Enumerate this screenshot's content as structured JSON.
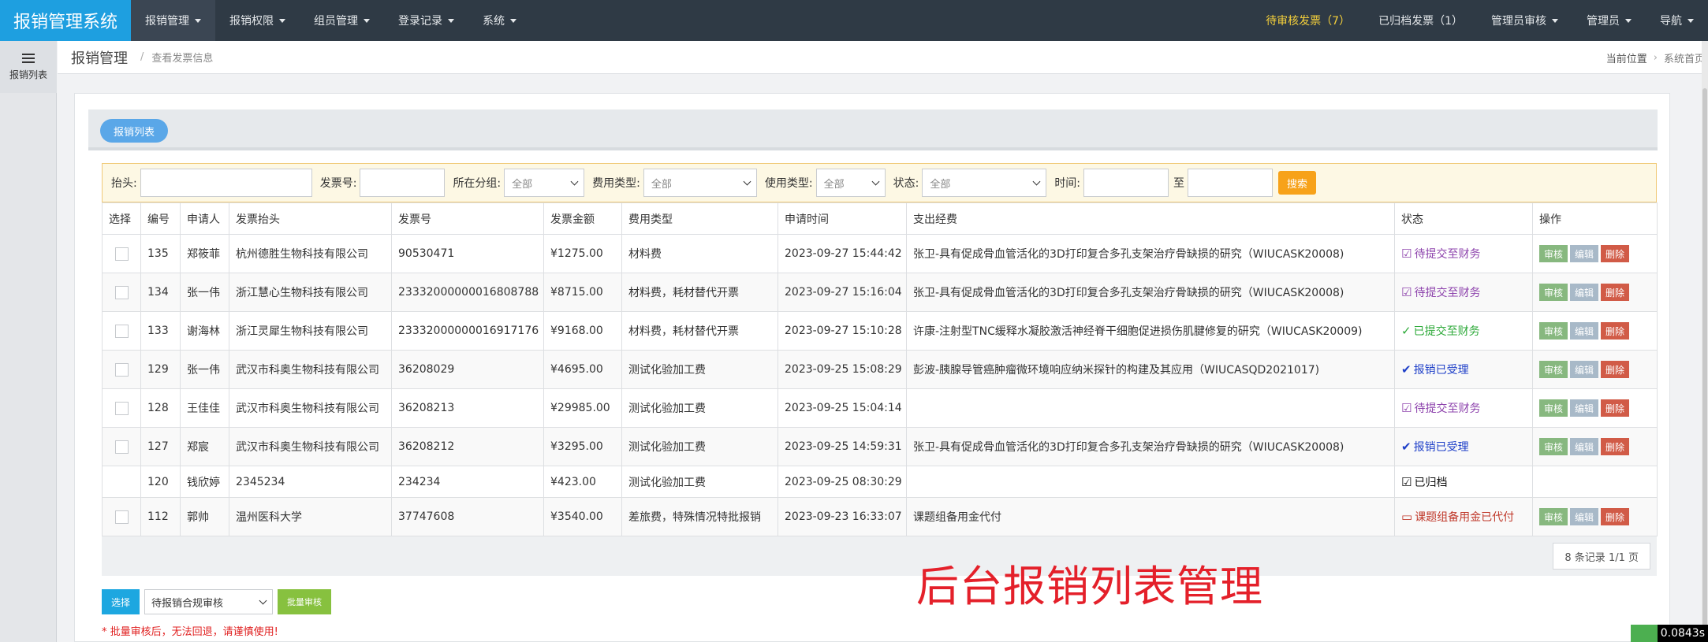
{
  "brand": "报销管理系统",
  "nav_left": [
    {
      "label": "报销管理"
    },
    {
      "label": "报销权限"
    },
    {
      "label": "组员管理"
    },
    {
      "label": "登录记录"
    },
    {
      "label": "系统"
    }
  ],
  "nav_right": {
    "pending": "待审核发票（7）",
    "archived": "已归档发票（1）",
    "admin_audit": "管理员审核",
    "admin": "管理员",
    "guide": "导航"
  },
  "sidebar": {
    "label": "报销列表",
    "icon": "list-icon"
  },
  "breadcrumb": {
    "title": "报销管理",
    "sep": "/",
    "sub": "查看发票信息",
    "position": "当前位置",
    "arrow": "›",
    "home": "系统首页"
  },
  "tab": {
    "label": "报销列表"
  },
  "filters": {
    "header_label": "抬头:",
    "invoice_no_label": "发票号:",
    "group_label": "所在分组:",
    "group_value": "全部",
    "expense_type_label": "费用类型:",
    "expense_type_value": "全部",
    "use_type_label": "使用类型:",
    "use_type_value": "全部",
    "status_label": "状态:",
    "status_value": "全部",
    "time_label": "时间:",
    "to_label": "至",
    "search_button": "搜索"
  },
  "table": {
    "columns": [
      "选择",
      "编号",
      "申请人",
      "发票抬头",
      "发票号",
      "发票金额",
      "费用类型",
      "申请时间",
      "支出经费",
      "状态",
      "操作"
    ],
    "action_labels": {
      "audit": "审核",
      "edit": "编辑",
      "delete": "删除"
    },
    "rows": [
      {
        "id": "135",
        "applicant": "郑筱菲",
        "header": "杭州德胜生物科技有限公司",
        "invoice_no": "90530471",
        "amount": "¥1275.00",
        "type": "材料费",
        "time": "2023-09-27 15:44:42",
        "fund": "张卫-具有促成骨血管活化的3D打印复合多孔支架治疗骨缺损的研究（WIUCASK20008)",
        "status": "待提交至财务",
        "status_kind": "purple",
        "checkbox": true,
        "actions": true
      },
      {
        "id": "134",
        "applicant": "张一伟",
        "header": "浙江慧心生物科技有限公司",
        "invoice_no": "23332000000016808788",
        "amount": "¥8715.00",
        "type": "材料费，耗材替代开票",
        "time": "2023-09-27 15:16:04",
        "fund": "张卫-具有促成骨血管活化的3D打印复合多孔支架治疗骨缺损的研究（WIUCASK20008)",
        "status": "待提交至财务",
        "status_kind": "purple",
        "checkbox": true,
        "actions": true
      },
      {
        "id": "133",
        "applicant": "谢海林",
        "header": "浙江灵犀生物科技有限公司",
        "invoice_no": "23332000000016917176",
        "amount": "¥9168.00",
        "type": "材料费，耗材替代开票",
        "time": "2023-09-27 15:10:28",
        "fund": "许康-注射型TNC缓释水凝胶激活神经脊干细胞促进损伤肌腱修复的研究（WIUCASK20009)",
        "status": "已提交至财务",
        "status_kind": "green",
        "checkbox": true,
        "actions": true
      },
      {
        "id": "129",
        "applicant": "张一伟",
        "header": "武汉市科奥生物科技有限公司",
        "invoice_no": "36208029",
        "amount": "¥4695.00",
        "type": "测试化验加工费",
        "time": "2023-09-25 15:08:29",
        "fund": "彭波-胰腺导管癌肿瘤微环境响应纳米探针的构建及其应用（WIUCASQD2021017)",
        "status": "报销已受理",
        "status_kind": "blue",
        "checkbox": true,
        "actions": true
      },
      {
        "id": "128",
        "applicant": "王佳佳",
        "header": "武汉市科奥生物科技有限公司",
        "invoice_no": "36208213",
        "amount": "¥29985.00",
        "type": "测试化验加工费",
        "time": "2023-09-25 15:04:14",
        "fund": "",
        "status": "待提交至财务",
        "status_kind": "purple",
        "checkbox": true,
        "actions": true
      },
      {
        "id": "127",
        "applicant": "郑宸",
        "header": "武汉市科奥生物科技有限公司",
        "invoice_no": "36208212",
        "amount": "¥3295.00",
        "type": "测试化验加工费",
        "time": "2023-09-25 14:59:31",
        "fund": "张卫-具有促成骨血管活化的3D打印复合多孔支架治疗骨缺损的研究（WIUCASK20008)",
        "status": "报销已受理",
        "status_kind": "blue",
        "checkbox": true,
        "actions": true
      },
      {
        "id": "120",
        "applicant": "钱欣婷",
        "header": "2345234",
        "invoice_no": "234234",
        "amount": "¥423.00",
        "type": "测试化验加工费",
        "time": "2023-09-25 08:30:29",
        "fund": "",
        "status": "已归档",
        "status_kind": "black",
        "checkbox": false,
        "actions": false
      },
      {
        "id": "112",
        "applicant": "郭帅",
        "header": "温州医科大学",
        "invoice_no": "37747608",
        "amount": "¥3540.00",
        "type": "差旅费，特殊情况特批报销",
        "time": "2023-09-23 16:33:07",
        "fund": "课题组备用金代付",
        "status": "课题组备用金已代付",
        "status_kind": "red",
        "checkbox": true,
        "actions": true
      }
    ]
  },
  "pager": "8 条记录 1/1 页",
  "batch": {
    "select_button": "选择",
    "select_value": "待报销合规审核",
    "batch_button": "批量审核",
    "warning": "* 批量审核后，无法回退，请谨慎使用!"
  },
  "overlay_caption": "后台报销列表管理",
  "timer": "0.0843s"
}
